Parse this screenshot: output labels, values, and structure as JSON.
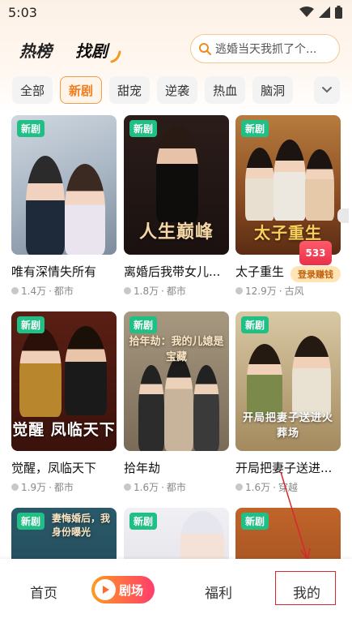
{
  "status_bar": {
    "time": "5:03"
  },
  "header": {
    "tabs": [
      {
        "label": "热榜"
      },
      {
        "label": "找剧"
      }
    ],
    "search_placeholder": "逃婚当天我抓了个..."
  },
  "categories": [
    "全部",
    "新剧",
    "甜宠",
    "逆袭",
    "热血",
    "脑洞"
  ],
  "active_category": "新剧",
  "badge_label": "新剧",
  "dramas": [
    {
      "title": "唯有深情失所有",
      "views": "1.4万",
      "genre": "都市",
      "overlay": ""
    },
    {
      "title": "离婚后我带女儿...",
      "views": "1.8万",
      "genre": "都市",
      "overlay": "人生巅峰"
    },
    {
      "title": "太子重生",
      "views": "12.9万",
      "genre": "古风",
      "overlay": "太子重生"
    },
    {
      "title": "觉醒，凤临天下",
      "views": "1.9万",
      "genre": "都市",
      "overlay": "觉醒 凤临天下"
    },
    {
      "title": "拾年劫",
      "views": "1.6万",
      "genre": "都市",
      "overlay": "拾年劫：我的儿媳是宝藏"
    },
    {
      "title": "开局把妻子送进...",
      "views": "1.6万",
      "genre": "穿越",
      "overlay": "开局把妻子送进火葬场"
    },
    {
      "title": "",
      "views": "",
      "genre": "",
      "overlay": "妻悔婚后，我身份曝光"
    },
    {
      "title": "",
      "views": "",
      "genre": "",
      "overlay": ""
    },
    {
      "title": "",
      "views": "",
      "genre": "",
      "overlay": ""
    }
  ],
  "reward": {
    "count": "533",
    "label": "登录赚钱"
  },
  "bottom_nav": {
    "home": "首页",
    "theater": "剧场",
    "welfare": "福利",
    "mine": "我的"
  },
  "colors": {
    "accent": "#f07d1f",
    "badge": "#1fbf86",
    "highlight": "#d9282f"
  }
}
